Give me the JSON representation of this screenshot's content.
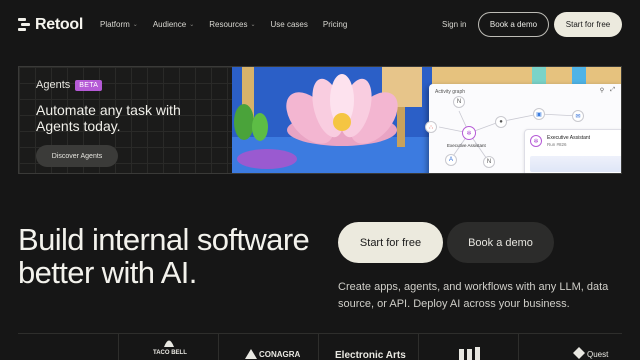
{
  "nav": {
    "brand": "Retool",
    "links": [
      {
        "label": "Platform",
        "has_menu": true
      },
      {
        "label": "Audience",
        "has_menu": true
      },
      {
        "label": "Resources",
        "has_menu": true
      },
      {
        "label": "Use cases",
        "has_menu": false
      },
      {
        "label": "Pricing",
        "has_menu": false
      }
    ],
    "sign_in": "Sign in",
    "book_demo": "Book a demo",
    "start_free": "Start for free"
  },
  "banner": {
    "kicker": "Agents",
    "badge": "BETA",
    "headline": "Automate any task with Agents today.",
    "cta": "Discover Agents",
    "panel": {
      "title": "Activity graph",
      "node_label": "Executive Assistant",
      "card_title": "Executive Assistant",
      "card_sub": "Run #826"
    }
  },
  "hero": {
    "title": "Build internal software better with AI.",
    "primary_cta": "Start for free",
    "secondary_cta": "Book a demo",
    "subtitle": "Create apps, agents, and workflows with any LLM, data source, or API. Deploy AI across your business."
  },
  "logos": {
    "items": [
      "TACO BELL",
      "CONAGRA",
      "Electronic Arts",
      "Quest"
    ]
  },
  "colors": {
    "background": "#161616",
    "primary_button": "#eceade",
    "beta_badge": "#b55ad6",
    "text": "#f3f2ec"
  }
}
